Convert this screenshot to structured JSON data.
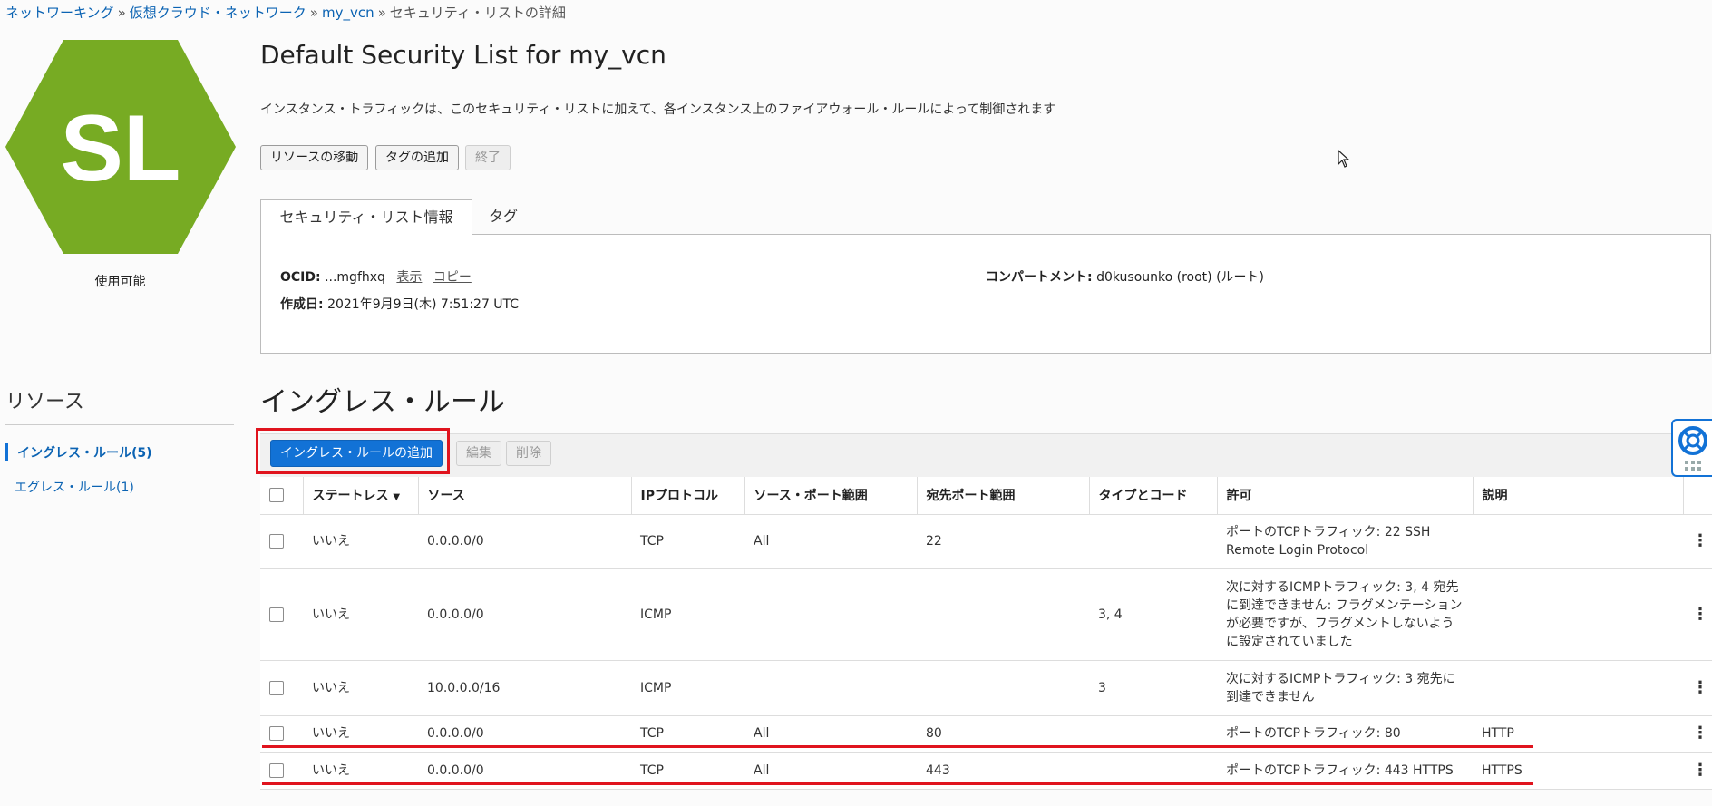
{
  "breadcrumb": {
    "items": [
      "ネットワーキング",
      "仮想クラウド・ネットワーク",
      "my_vcn"
    ],
    "current": "セキュリティ・リストの詳細",
    "separator": "»"
  },
  "resource_icon": {
    "text": "SL",
    "color": "#77ab23",
    "status": "使用可能"
  },
  "title": "Default Security List for my_vcn",
  "description": "インスタンス・トラフィックは、このセキュリティ・リストに加えて、各インスタンス上のファイアウォール・ルールによって制御されます",
  "actions": {
    "move": "リソースの移動",
    "add_tag": "タグの追加",
    "terminate": "終了"
  },
  "tabs": {
    "info": "セキュリティ・リスト情報",
    "tags": "タグ"
  },
  "info": {
    "ocid_label": "OCID:",
    "ocid_value": "...mgfhxq",
    "show": "表示",
    "copy": "コピー",
    "created_label": "作成日:",
    "created_value": "2021年9月9日(木) 7:51:27 UTC",
    "compartment_label": "コンパートメント:",
    "compartment_value": "d0kusounko (root) (ルート)"
  },
  "resources": {
    "title": "リソース",
    "items": [
      "イングレス・ルール(5)",
      "エグレス・ルール(1)"
    ]
  },
  "section_title": "イングレス・ルール",
  "toolbar": {
    "add": "イングレス・ルールの追加",
    "edit": "編集",
    "delete": "削除"
  },
  "table": {
    "headers": [
      "ステートレス",
      "ソース",
      "IPプロトコル",
      "ソース・ポート範囲",
      "宛先ポート範囲",
      "タイプとコード",
      "許可",
      "説明"
    ],
    "rows": [
      {
        "stateless": "いいえ",
        "source": "0.0.0.0/0",
        "protocol": "TCP",
        "src_port": "All",
        "dst_port": "22",
        "type_code": "",
        "allow": "ポートのTCPトラフィック: 22 SSH Remote Login Protocol",
        "desc": ""
      },
      {
        "stateless": "いいえ",
        "source": "0.0.0.0/0",
        "protocol": "ICMP",
        "src_port": "",
        "dst_port": "",
        "type_code": "3, 4",
        "allow": "次に対するICMPトラフィック: 3, 4 宛先に到達できません: フラグメンテーションが必要ですが、フラグメントしないように設定されていました",
        "desc": ""
      },
      {
        "stateless": "いいえ",
        "source": "10.0.0.0/16",
        "protocol": "ICMP",
        "src_port": "",
        "dst_port": "",
        "type_code": "3",
        "allow": "次に対するICMPトラフィック: 3 宛先に到達できません",
        "desc": ""
      },
      {
        "stateless": "いいえ",
        "source": "0.0.0.0/0",
        "protocol": "TCP",
        "src_port": "All",
        "dst_port": "80",
        "type_code": "",
        "allow": "ポートのTCPトラフィック: 80",
        "desc": "HTTP"
      },
      {
        "stateless": "いいえ",
        "source": "0.0.0.0/0",
        "protocol": "TCP",
        "src_port": "All",
        "dst_port": "443",
        "type_code": "",
        "allow": "ポートのTCPトラフィック: 443 HTTPS",
        "desc": "HTTPS"
      }
    ]
  },
  "kebab": "⋮",
  "sort_indicator": "▼",
  "colors": {
    "link": "#0b63b3",
    "primary": "#1272d6",
    "annotation_red": "#e0141e",
    "hex_green": "#77ab23"
  }
}
